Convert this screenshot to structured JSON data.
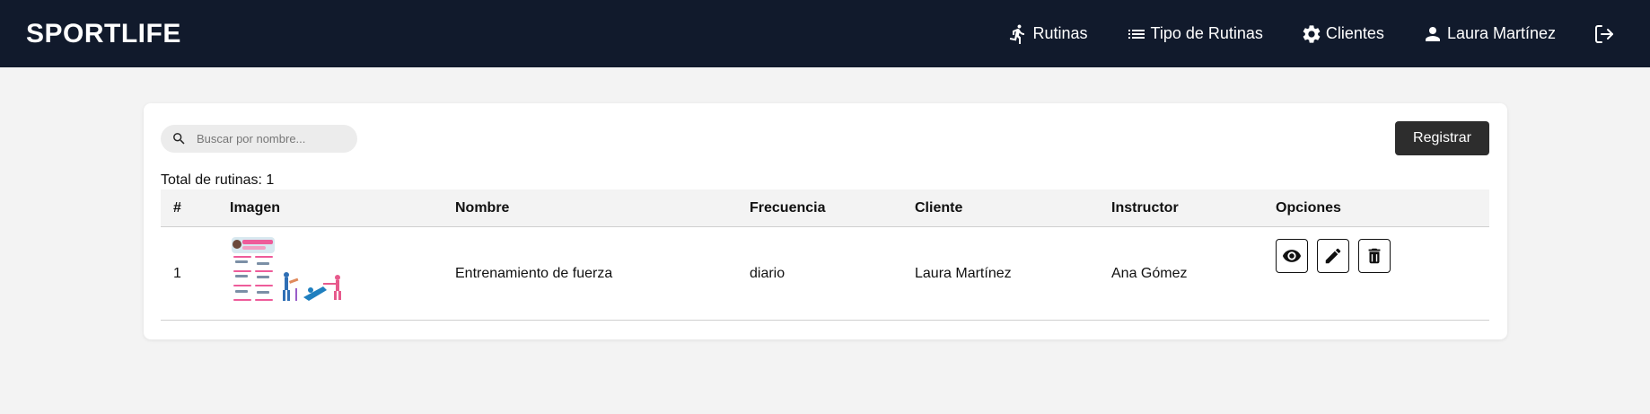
{
  "navbar": {
    "brand": "SPORTLIFE",
    "items": [
      {
        "label": "Rutinas",
        "icon": "running-icon"
      },
      {
        "label": "Tipo de Rutinas",
        "icon": "list-icon"
      },
      {
        "label": "Clientes",
        "icon": "gear-icon"
      },
      {
        "label": "Laura Martínez",
        "icon": "user-icon"
      }
    ],
    "logout_icon": "logout-icon"
  },
  "search": {
    "placeholder": "Buscar por nombre...",
    "value": ""
  },
  "register_label": "Registrar",
  "total_label": "Total de rutinas: 1",
  "table": {
    "headers": [
      "#",
      "Imagen",
      "Nombre",
      "Frecuencia",
      "Cliente",
      "Instructor",
      "Opciones"
    ],
    "rows": [
      {
        "num": "1",
        "image_alt": "routine-thumbnail",
        "nombre": "Entrenamiento de fuerza",
        "frecuencia": "diario",
        "cliente": "Laura Martínez",
        "instructor": "Ana Gómez"
      }
    ],
    "options": [
      "view-icon",
      "edit-icon",
      "delete-icon"
    ]
  }
}
